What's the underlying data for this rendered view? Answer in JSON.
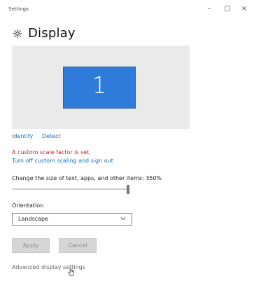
{
  "window": {
    "title": "Settings",
    "controls": {
      "minimize": "–",
      "maximize": "□",
      "close": "×"
    }
  },
  "page": {
    "title": "Display",
    "icon": "gear-icon"
  },
  "display_preview": {
    "monitor_number": "1",
    "monitor_color": "#2f7bd9"
  },
  "actions": {
    "identify": "Identify",
    "detect": "Detect"
  },
  "scaling": {
    "warning": "A custom scale factor is set.",
    "signout_link": "Turn off custom scaling and sign out",
    "label": "Change the size of text, apps, and other items: 350%",
    "value_percent": 350
  },
  "orientation": {
    "label": "Orientation",
    "selected": "Landscape"
  },
  "buttons": {
    "apply": "Apply",
    "cancel": "Cancel"
  },
  "advanced": {
    "label": "Advanced display settings"
  },
  "colors": {
    "link": "#1a6fb5",
    "warning": "#d11d1d",
    "accent_monitor": "#2f7bd9"
  }
}
